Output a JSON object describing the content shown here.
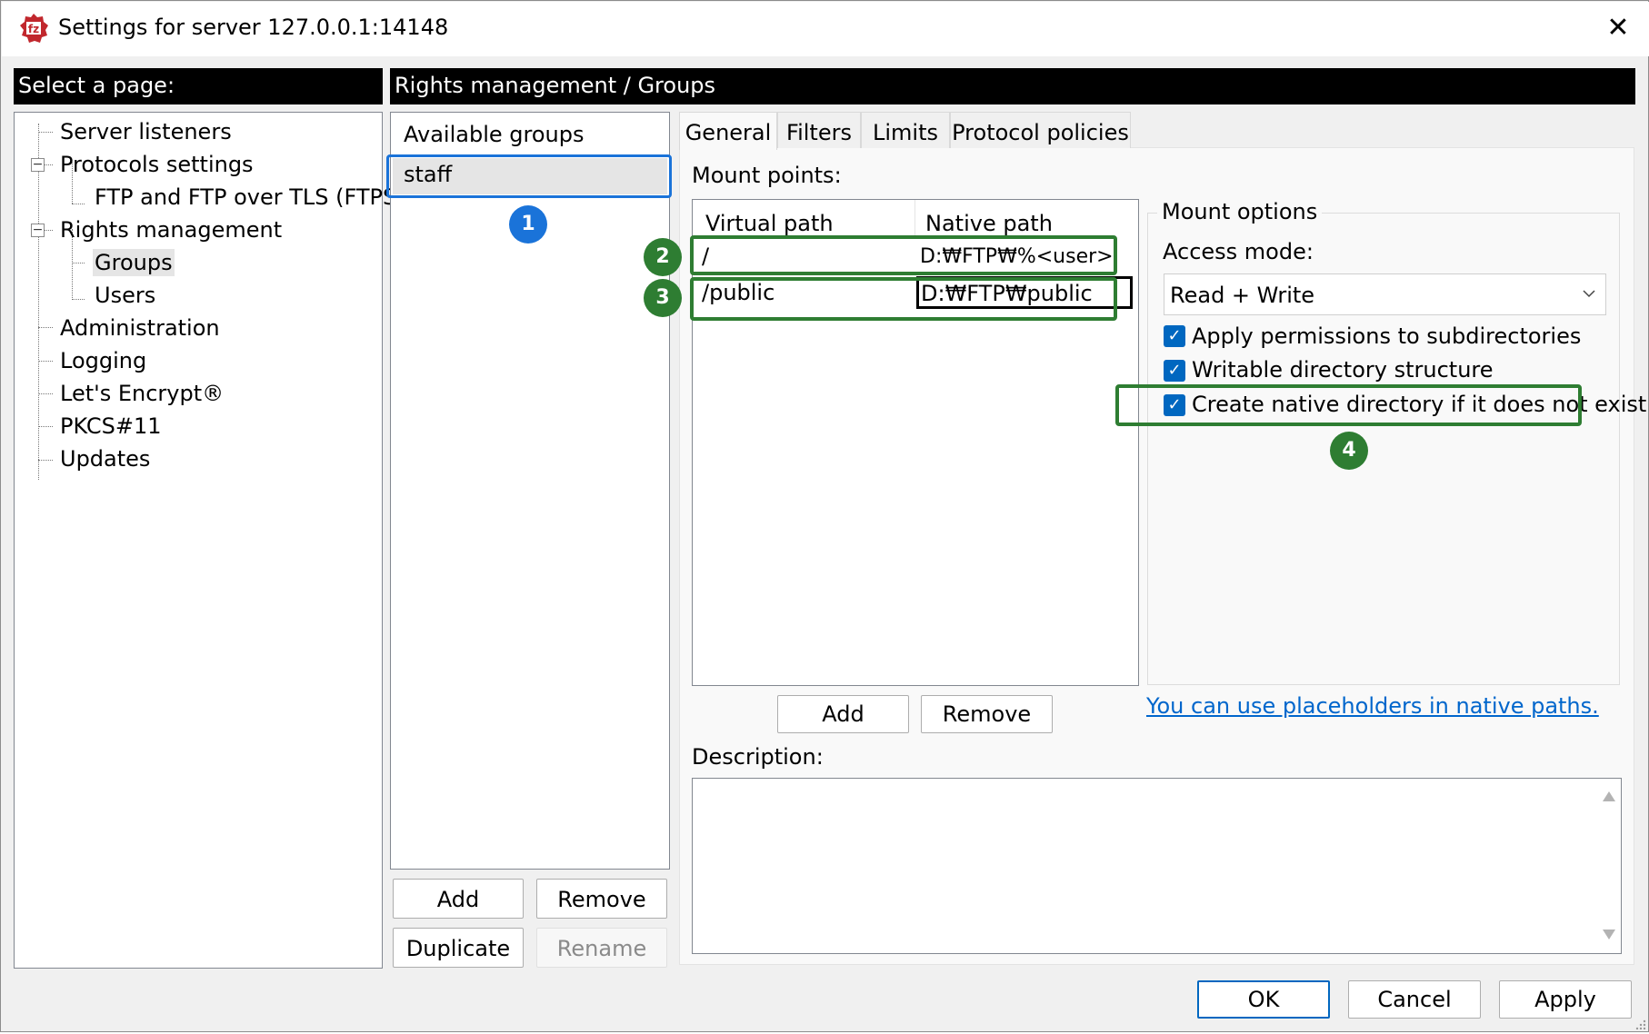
{
  "window": {
    "title": "Settings for server 127.0.0.1:14148"
  },
  "left_header": "Select a page:",
  "right_header": "Rights management / Groups",
  "tree": {
    "server_listeners": "Server listeners",
    "protocols_settings": "Protocols settings",
    "ftp_ftps": "FTP and FTP over TLS (FTPS)",
    "rights_management": "Rights management",
    "groups": "Groups",
    "users": "Users",
    "administration": "Administration",
    "logging": "Logging",
    "lets_encrypt": "Let's Encrypt®",
    "pkcs11": "PKCS#11",
    "updates": "Updates"
  },
  "groups": {
    "header": "Available groups",
    "items": [
      "staff"
    ],
    "add": "Add",
    "remove": "Remove",
    "duplicate": "Duplicate",
    "rename": "Rename"
  },
  "tabs": [
    "General",
    "Filters",
    "Limits",
    "Protocol policies"
  ],
  "mount": {
    "label": "Mount points:",
    "col_virtual": "Virtual path",
    "col_native": "Native path",
    "rows": [
      {
        "virtual": "/",
        "native": "D:₩FTP₩%<user>"
      },
      {
        "virtual": "/public",
        "native": "D:₩FTP₩public"
      }
    ],
    "add": "Add",
    "remove": "Remove"
  },
  "mount_options": {
    "legend": "Mount options",
    "access_label": "Access mode:",
    "access_value": "Read + Write",
    "apply_permissions": "Apply permissions to subdirectories",
    "writable_structure": "Writable directory structure",
    "create_native": "Create native directory if it does not exist"
  },
  "placeholder_link": "You can use placeholders in native paths.",
  "description_label": "Description:",
  "footer": {
    "ok": "OK",
    "cancel": "Cancel",
    "apply": "Apply"
  },
  "markers": [
    "1",
    "2",
    "3",
    "4"
  ],
  "colors": {
    "accent": "#0067c0",
    "marker_blue": "#1a73d9",
    "marker_green": "#2e7d32",
    "link": "#0066cc"
  }
}
